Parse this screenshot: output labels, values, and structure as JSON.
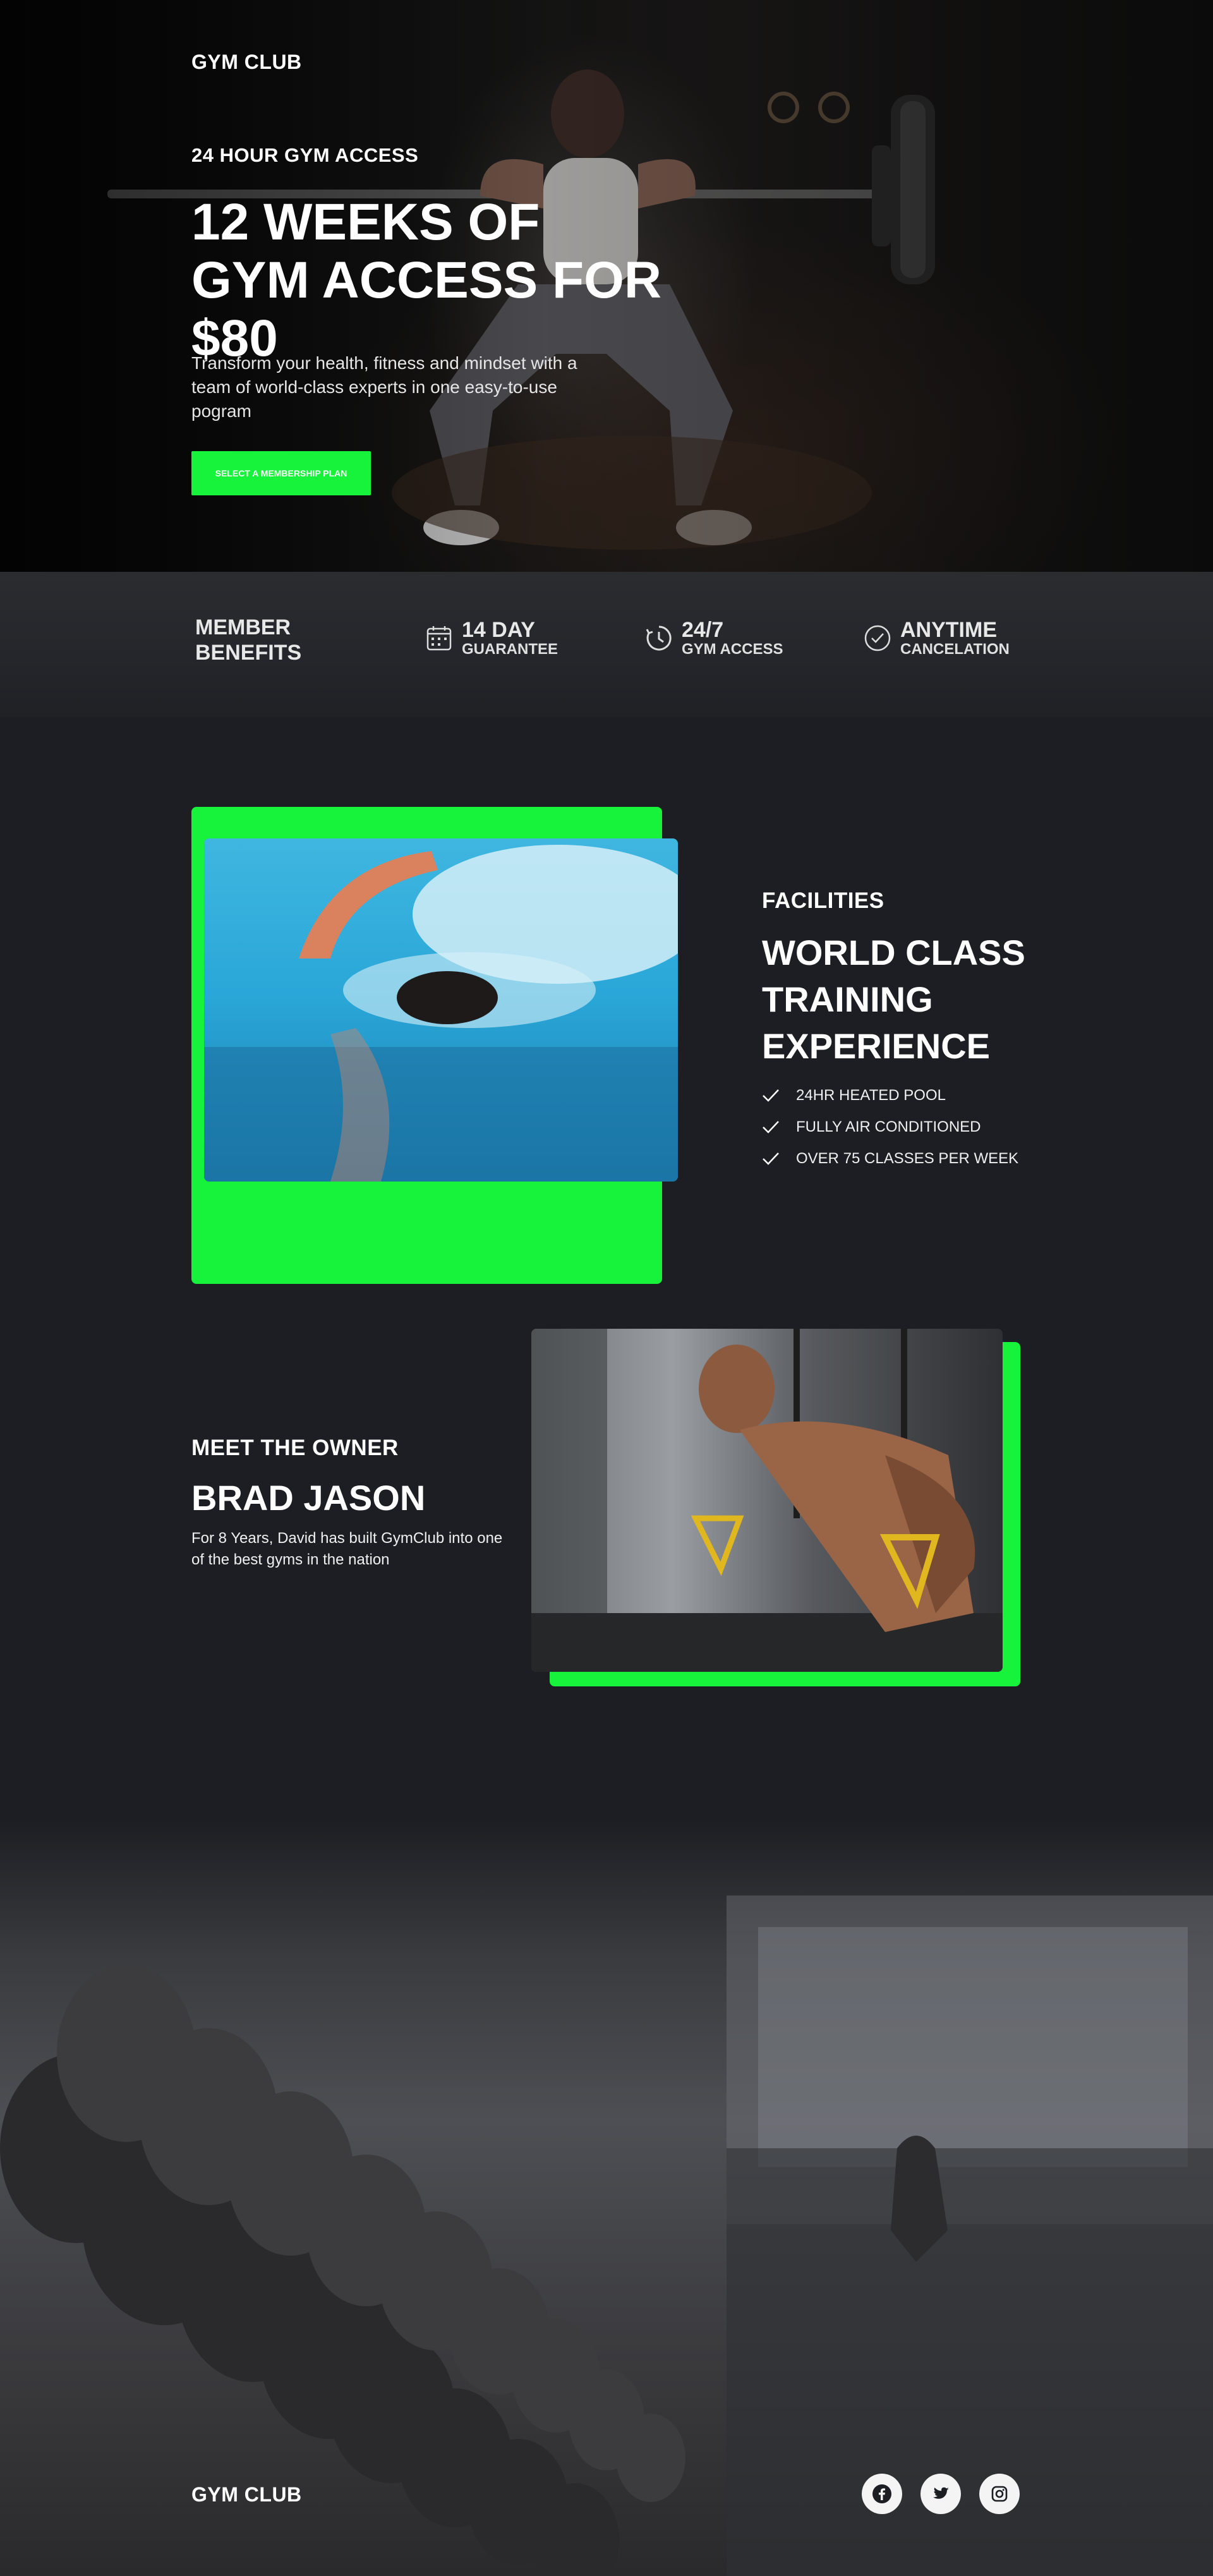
{
  "brand": "GYM CLUB",
  "hero": {
    "eyebrow": "24 HOUR GYM ACCESS",
    "title": "12 WEEKS OF GYM ACCESS FOR $80",
    "subtitle": "Transform your health, fitness and mindset with a team of world-class experts in one easy-to-use pogram",
    "cta": "SELECT A MEMBERSHIP PLAN"
  },
  "benefits": {
    "title_line1": "MEMBER",
    "title_line2": "BENEFITS",
    "items": [
      {
        "big": "14 DAY",
        "small": "GUARANTEE",
        "icon": "calendar-icon"
      },
      {
        "big": "24/7",
        "small": "GYM ACCESS",
        "icon": "clock-icon"
      },
      {
        "big": "ANYTIME",
        "small": "CANCELATION",
        "icon": "check-circle-icon"
      }
    ]
  },
  "facilities": {
    "eyebrow": "FACILITIES",
    "title": "WORLD CLASS TRAINING EXPERIENCE",
    "features": [
      "24HR HEATED POOL",
      "FULLY AIR CONDITIONED",
      "OVER 75 CLASSES PER WEEK"
    ]
  },
  "owner": {
    "eyebrow": "MEET THE OWNER",
    "name": "BRAD JASON",
    "bio": "For 8 Years, David has built GymClub into one of the best gyms in the nation"
  },
  "footer": {
    "brand": "GYM CLUB",
    "social": [
      "facebook-icon",
      "twitter-icon",
      "instagram-icon"
    ]
  },
  "colors": {
    "accent": "#17f23b",
    "background": "#1c1e23",
    "text": "#ffffff"
  }
}
